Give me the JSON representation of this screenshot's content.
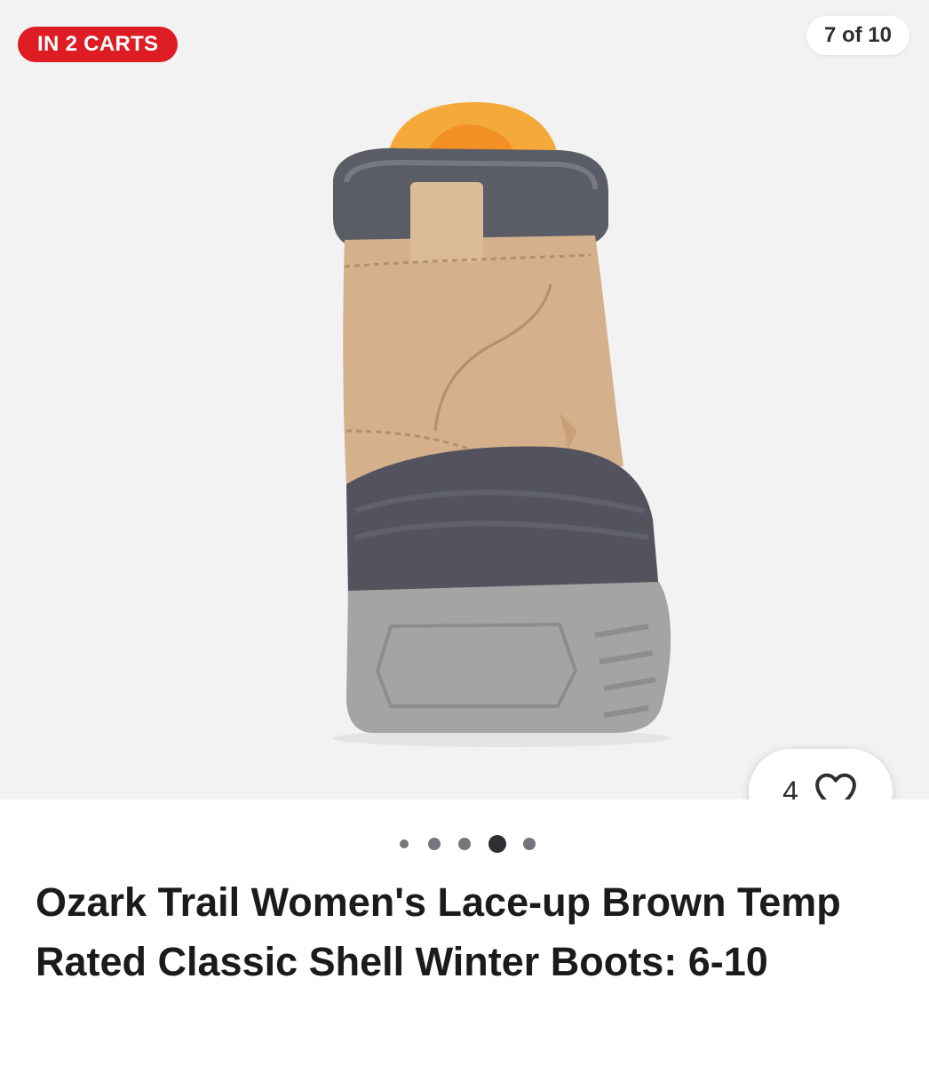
{
  "gallery": {
    "carts_badge": "IN 2 CARTS",
    "page_counter": "7 of 10",
    "product_image_icon": "winter-boot-rear-view"
  },
  "favorite": {
    "count": "4",
    "icon": "heart-outline-icon"
  },
  "pagination": {
    "dot_count": 5,
    "active_index": 3
  },
  "product": {
    "title": "Ozark Trail Women's Lace-up Brown Temp Rated Classic Shell Winter Boots: 6-10"
  },
  "colors": {
    "badge_red": "#de1c24",
    "gallery_bg": "#f2f2f2",
    "dot_active": "#2e2f32",
    "dot_inactive": "#74767c",
    "title_text": "#1b1b1b"
  }
}
